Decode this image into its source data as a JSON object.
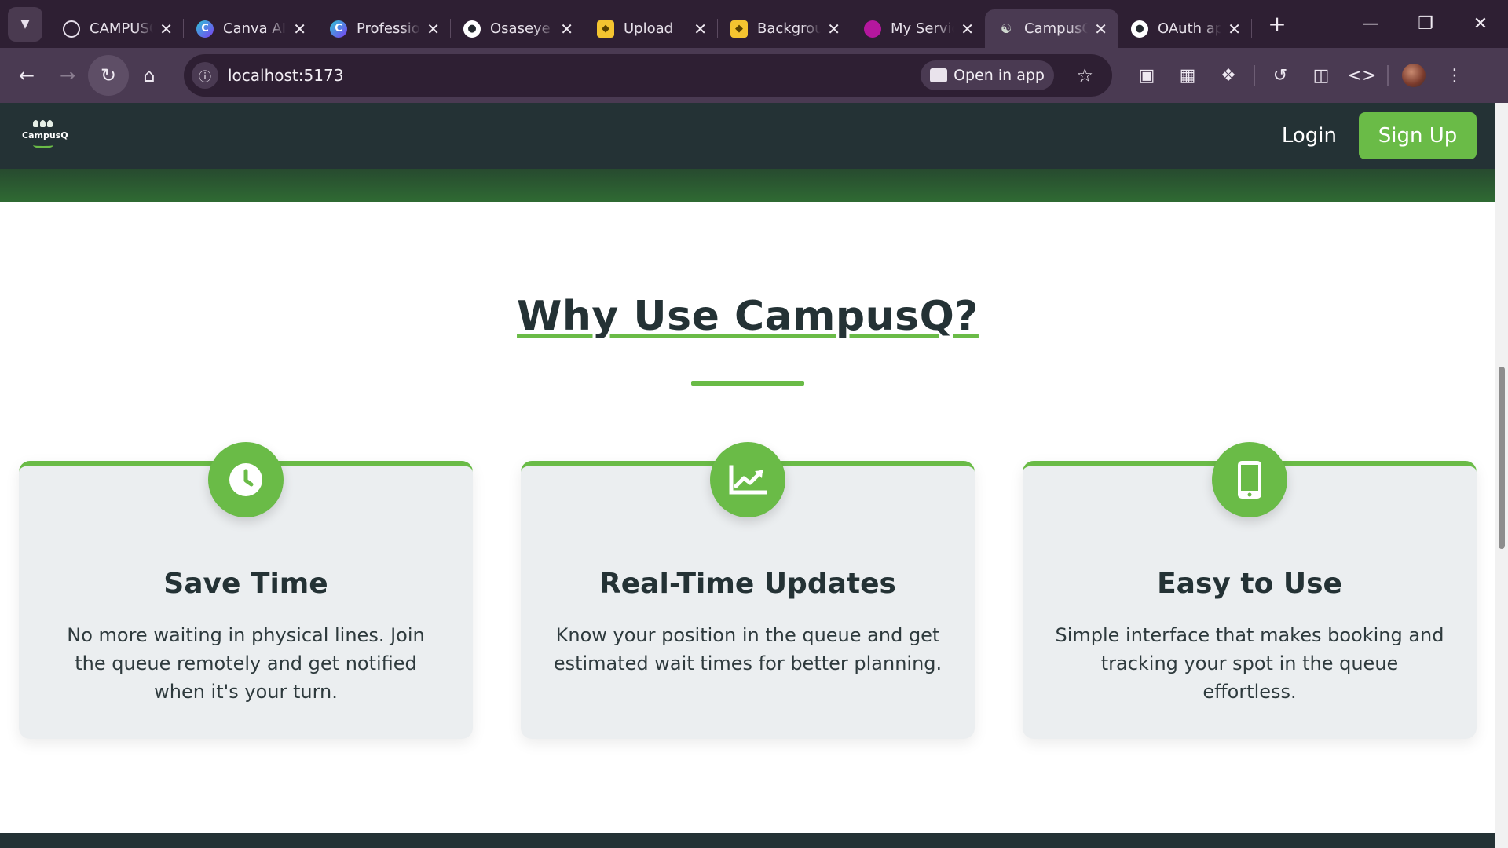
{
  "browser": {
    "tabs": [
      {
        "label": "CAMPUSQ",
        "icon": "openai-icon",
        "active": false
      },
      {
        "label": "Canva AI",
        "icon": "canva-icon",
        "active": false
      },
      {
        "label": "Professional",
        "icon": "canva-icon",
        "active": false
      },
      {
        "label": "Osaseye",
        "icon": "github-icon",
        "active": false
      },
      {
        "label": "Upload",
        "icon": "layers-icon",
        "active": false
      },
      {
        "label": "Background",
        "icon": "layers-icon",
        "active": false
      },
      {
        "label": "My Services",
        "icon": "app-icon",
        "active": false
      },
      {
        "label": "CampusQ",
        "icon": "campusq-icon",
        "active": true
      },
      {
        "label": "OAuth apps",
        "icon": "github-icon",
        "active": false
      }
    ],
    "url": "localhost:5173",
    "open_in_app_label": "Open in app"
  },
  "site": {
    "nav": {
      "logo_text": "CampusQ",
      "login_label": "Login",
      "signup_label": "Sign Up"
    },
    "section_title": "Why Use CampusQ?",
    "features": [
      {
        "icon": "clock-icon",
        "title": "Save Time",
        "description": "No more waiting in physical lines. Join the queue remotely and get notified when it's your turn."
      },
      {
        "icon": "chart-line-icon",
        "title": "Real-Time Updates",
        "description": "Know your position in the queue and get estimated wait times for better planning."
      },
      {
        "icon": "mobile-icon",
        "title": "Easy to Use",
        "description": "Simple interface that makes booking and tracking your spot in the queue effortless."
      }
    ]
  },
  "colors": {
    "accent_green": "#6abb47",
    "dark_slate": "#243235",
    "browser_frame": "#2e1f33"
  }
}
